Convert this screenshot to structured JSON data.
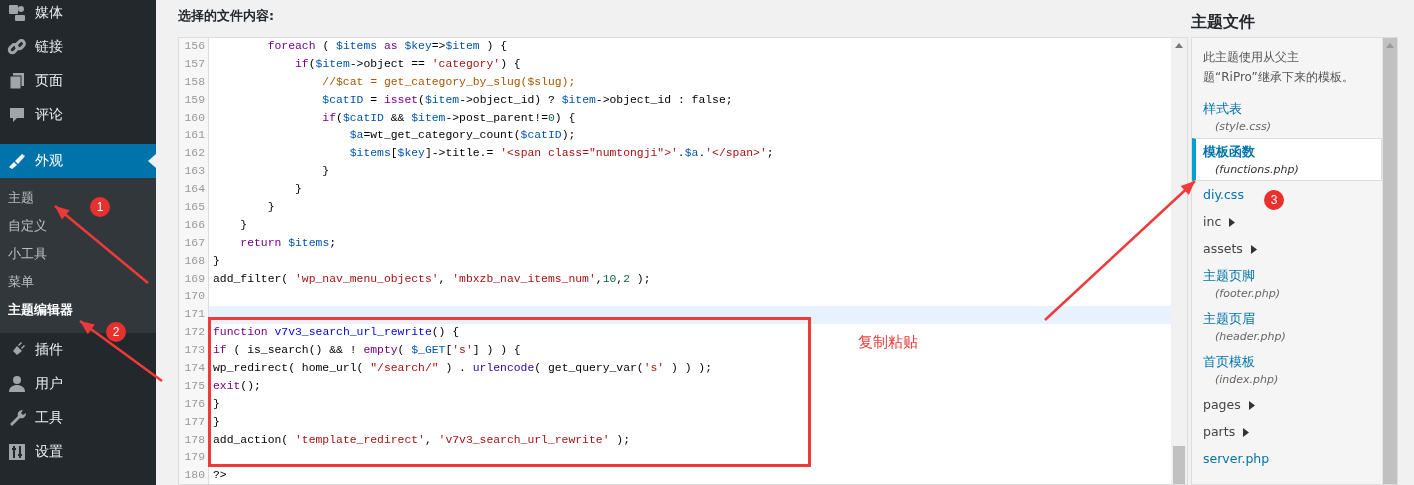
{
  "sidebar": {
    "items": [
      {
        "label": "媒体",
        "selected": false
      },
      {
        "label": "链接",
        "selected": false
      },
      {
        "label": "页面",
        "selected": false
      },
      {
        "label": "评论",
        "selected": false
      },
      {
        "label": "外观",
        "selected": true,
        "children": [
          {
            "label": "主题",
            "selected": false
          },
          {
            "label": "自定义",
            "selected": false
          },
          {
            "label": "小工具",
            "selected": false
          },
          {
            "label": "菜单",
            "selected": false
          },
          {
            "label": "主题编辑器",
            "selected": true
          }
        ]
      },
      {
        "label": "插件",
        "selected": false
      },
      {
        "label": "用户",
        "selected": false
      },
      {
        "label": "工具",
        "selected": false
      },
      {
        "label": "设置",
        "selected": false
      }
    ]
  },
  "editor": {
    "heading": "选择的文件内容:",
    "lines": [
      {
        "number": "156",
        "highlighted": false,
        "tokens": [
          {
            "kind": "keyword",
            "text": "        foreach"
          },
          {
            "kind": "plain",
            "text": " ( "
          },
          {
            "kind": "variable",
            "text": "$items "
          },
          {
            "kind": "keyword",
            "text": "as "
          },
          {
            "kind": "variable",
            "text": "$key"
          },
          {
            "kind": "plain",
            "text": "=>"
          },
          {
            "kind": "variable",
            "text": "$item"
          },
          {
            "kind": "plain",
            "text": " ) {"
          }
        ]
      },
      {
        "number": "157",
        "highlighted": false,
        "tokens": [
          {
            "kind": "keyword",
            "text": "            if"
          },
          {
            "kind": "plain",
            "text": "("
          },
          {
            "kind": "variable",
            "text": "$item"
          },
          {
            "kind": "plain",
            "text": "->object == "
          },
          {
            "kind": "string",
            "text": "'category'"
          },
          {
            "kind": "plain",
            "text": ") {"
          }
        ]
      },
      {
        "number": "158",
        "highlighted": false,
        "tokens": [
          {
            "kind": "comment",
            "text": "                //$cat = get_category_by_slug($slug);"
          }
        ]
      },
      {
        "number": "159",
        "highlighted": false,
        "tokens": [
          {
            "kind": "variable",
            "text": "                $catID"
          },
          {
            "kind": "plain",
            "text": " = "
          },
          {
            "kind": "keyword",
            "text": "isset"
          },
          {
            "kind": "plain",
            "text": "("
          },
          {
            "kind": "variable",
            "text": "$item"
          },
          {
            "kind": "plain",
            "text": "->object_id) ? "
          },
          {
            "kind": "variable",
            "text": "$item"
          },
          {
            "kind": "plain",
            "text": "->object_id : false;"
          }
        ]
      },
      {
        "number": "160",
        "highlighted": false,
        "tokens": [
          {
            "kind": "keyword",
            "text": "                if"
          },
          {
            "kind": "plain",
            "text": "("
          },
          {
            "kind": "variable",
            "text": "$catID"
          },
          {
            "kind": "plain",
            "text": " && "
          },
          {
            "kind": "variable",
            "text": "$item"
          },
          {
            "kind": "plain",
            "text": "->post_parent!="
          },
          {
            "kind": "number",
            "text": "0"
          },
          {
            "kind": "plain",
            "text": ") {"
          }
        ]
      },
      {
        "number": "161",
        "highlighted": false,
        "tokens": [
          {
            "kind": "variable",
            "text": "                    $a"
          },
          {
            "kind": "plain",
            "text": "=wt_get_category_count("
          },
          {
            "kind": "variable",
            "text": "$catID"
          },
          {
            "kind": "plain",
            "text": ");"
          }
        ]
      },
      {
        "number": "162",
        "highlighted": false,
        "tokens": [
          {
            "kind": "variable",
            "text": "                    $items"
          },
          {
            "kind": "plain",
            "text": "["
          },
          {
            "kind": "variable",
            "text": "$key"
          },
          {
            "kind": "plain",
            "text": "]->title.= "
          },
          {
            "kind": "string",
            "text": "'<span class=\"numtongji\">'"
          },
          {
            "kind": "plain",
            "text": "."
          },
          {
            "kind": "variable",
            "text": "$a"
          },
          {
            "kind": "plain",
            "text": "."
          },
          {
            "kind": "string",
            "text": "'</span>'"
          },
          {
            "kind": "plain",
            "text": ";"
          }
        ]
      },
      {
        "number": "163",
        "highlighted": false,
        "tokens": [
          {
            "kind": "plain",
            "text": "                }"
          }
        ]
      },
      {
        "number": "164",
        "highlighted": false,
        "tokens": [
          {
            "kind": "plain",
            "text": "            }"
          }
        ]
      },
      {
        "number": "165",
        "highlighted": false,
        "tokens": [
          {
            "kind": "plain",
            "text": "        }"
          }
        ]
      },
      {
        "number": "166",
        "highlighted": false,
        "tokens": [
          {
            "kind": "plain",
            "text": "    }"
          }
        ]
      },
      {
        "number": "167",
        "highlighted": false,
        "tokens": [
          {
            "kind": "keyword",
            "text": "    return "
          },
          {
            "kind": "variable",
            "text": "$items"
          },
          {
            "kind": "plain",
            "text": ";"
          }
        ]
      },
      {
        "number": "168",
        "highlighted": false,
        "tokens": [
          {
            "kind": "plain",
            "text": "}"
          }
        ]
      },
      {
        "number": "169",
        "highlighted": false,
        "tokens": [
          {
            "kind": "plain",
            "text": "add_filter( "
          },
          {
            "kind": "string",
            "text": "'wp_nav_menu_objects'"
          },
          {
            "kind": "plain",
            "text": ", "
          },
          {
            "kind": "string",
            "text": "'mbxzb_nav_items_num'"
          },
          {
            "kind": "plain",
            "text": ","
          },
          {
            "kind": "number",
            "text": "10"
          },
          {
            "kind": "plain",
            "text": ","
          },
          {
            "kind": "number",
            "text": "2"
          },
          {
            "kind": "plain",
            "text": " );"
          }
        ]
      },
      {
        "number": "170",
        "highlighted": false
      },
      {
        "number": "171",
        "highlighted": true
      },
      {
        "number": "172",
        "highlighted": false,
        "tokens": [
          {
            "kind": "keyword",
            "text": "function "
          },
          {
            "kind": "definition",
            "text": "v7v3_search_url_rewrite"
          },
          {
            "kind": "plain",
            "text": "() {"
          }
        ]
      },
      {
        "number": "173",
        "highlighted": false,
        "tokens": [
          {
            "kind": "keyword",
            "text": "if"
          },
          {
            "kind": "plain",
            "text": " ( is_search() && ! "
          },
          {
            "kind": "keyword",
            "text": "empty"
          },
          {
            "kind": "plain",
            "text": "( "
          },
          {
            "kind": "variable",
            "text": "$_GET"
          },
          {
            "kind": "plain",
            "text": "["
          },
          {
            "kind": "string",
            "text": "'s'"
          },
          {
            "kind": "plain",
            "text": "] ) ) {"
          }
        ]
      },
      {
        "number": "174",
        "highlighted": false,
        "tokens": [
          {
            "kind": "plain",
            "text": "wp_redirect( home_url( "
          },
          {
            "kind": "string",
            "text": "\"/search/\""
          },
          {
            "kind": "plain",
            "text": " ) . "
          },
          {
            "kind": "builtin",
            "text": "urlencode"
          },
          {
            "kind": "plain",
            "text": "( get_query_var("
          },
          {
            "kind": "string",
            "text": "'s'"
          },
          {
            "kind": "plain",
            "text": " ) ) );"
          }
        ]
      },
      {
        "number": "175",
        "highlighted": false,
        "tokens": [
          {
            "kind": "keyword",
            "text": "exit"
          },
          {
            "kind": "plain",
            "text": "();"
          }
        ]
      },
      {
        "number": "176",
        "highlighted": false,
        "tokens": [
          {
            "kind": "plain",
            "text": "}"
          }
        ]
      },
      {
        "number": "177",
        "highlighted": false,
        "tokens": [
          {
            "kind": "plain",
            "text": "}"
          }
        ]
      },
      {
        "number": "178",
        "highlighted": false,
        "tokens": [
          {
            "kind": "plain",
            "text": "add_action( "
          },
          {
            "kind": "string",
            "text": "'template_redirect'"
          },
          {
            "kind": "plain",
            "text": ", "
          },
          {
            "kind": "string",
            "text": "'v7v3_search_url_rewrite'"
          },
          {
            "kind": "plain",
            "text": " );"
          }
        ]
      },
      {
        "number": "179",
        "highlighted": false
      },
      {
        "number": "180",
        "highlighted": false,
        "tokens": [
          {
            "kind": "plain",
            "text": "?>"
          }
        ]
      }
    ]
  },
  "theme_files": {
    "heading": "主题文件",
    "description": "此主题使用从父主题“RiPro”继承下来的模板。",
    "items": [
      {
        "kind": "file",
        "label": "样式表",
        "filename": "(style.css)",
        "selected": false
      },
      {
        "kind": "file",
        "label": "模板函数",
        "filename": "(functions.php)",
        "selected": true
      },
      {
        "kind": "file",
        "label": "diy.css",
        "selected": false
      },
      {
        "kind": "folder",
        "label": "inc",
        "selected": false
      },
      {
        "kind": "folder",
        "label": "assets",
        "selected": false
      },
      {
        "kind": "file",
        "label": "主题页脚",
        "filename": "(footer.php)",
        "selected": false
      },
      {
        "kind": "file",
        "label": "主题页眉",
        "filename": "(header.php)",
        "selected": false
      },
      {
        "kind": "file",
        "label": "首页模板",
        "filename": "(index.php)",
        "selected": false
      },
      {
        "kind": "folder",
        "label": "pages",
        "selected": false
      },
      {
        "kind": "folder",
        "label": "parts",
        "selected": false
      },
      {
        "kind": "file",
        "label": "server.php",
        "selected": false
      }
    ]
  },
  "annotations": {
    "badges": [
      "1",
      "2",
      "3"
    ],
    "note": "复制粘贴"
  }
}
